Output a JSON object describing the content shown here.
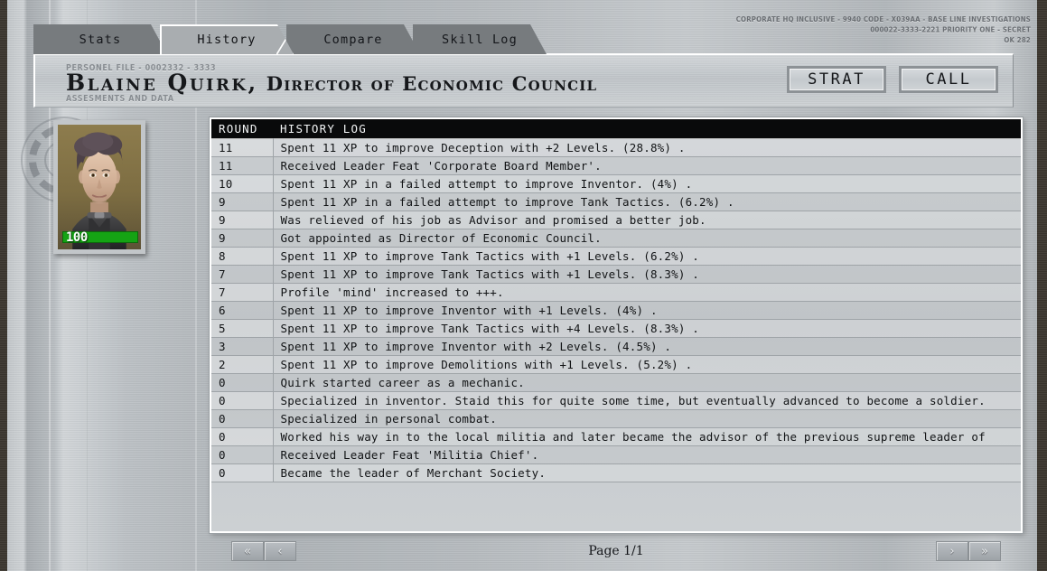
{
  "stamp": {
    "line1": "CORPORATE HQ INCLUSIVE - 9940 CODE - X039AA - BASE LINE INVESTIGATIONS",
    "line2": "000022-3333-2221 PRIORITY ONE - SECRET",
    "line3": "OK 282"
  },
  "tabs": [
    {
      "label": "Stats",
      "active": false
    },
    {
      "label": "History",
      "active": true
    },
    {
      "label": "Compare",
      "active": false
    },
    {
      "label": "Skill Log",
      "active": false
    }
  ],
  "header": {
    "file_label": "PERSONEL FILE - 0002332 - 3333",
    "data_label": "ASSESMENTS AND DATA",
    "name": "Blaine Quirk,",
    "role": "Director of Economic Council",
    "buttons": [
      {
        "label": "STRAT",
        "name": "strat-button"
      },
      {
        "label": "CALL",
        "name": "call-button"
      }
    ]
  },
  "portrait": {
    "health_value": "100",
    "health_percent": 100,
    "health_color": "#15a314"
  },
  "log": {
    "columns": [
      "ROUND",
      "HISTORY LOG"
    ],
    "rows": [
      {
        "round": "11",
        "text": "Spent 11 XP to improve Deception with +2 Levels. (28.8%) ."
      },
      {
        "round": "11",
        "text": "Received Leader Feat 'Corporate Board Member'."
      },
      {
        "round": "10",
        "text": "Spent 11 XP in a failed attempt to improve Inventor. (4%) ."
      },
      {
        "round": "9",
        "text": "Spent 11 XP in a failed attempt to improve Tank Tactics. (6.2%) ."
      },
      {
        "round": "9",
        "text": "Was relieved of his job as Advisor and promised a better job."
      },
      {
        "round": "9",
        "text": "Got appointed as Director of Economic Council."
      },
      {
        "round": "8",
        "text": "Spent 11 XP to improve Tank Tactics with +1 Levels. (6.2%) ."
      },
      {
        "round": "7",
        "text": "Spent 11 XP to improve Tank Tactics with +1 Levels. (8.3%) ."
      },
      {
        "round": "7",
        "text": "Profile 'mind' increased to +++."
      },
      {
        "round": "6",
        "text": "Spent 11 XP to improve Inventor with +1 Levels. (4%) ."
      },
      {
        "round": "5",
        "text": "Spent 11 XP to improve Tank Tactics with +4 Levels. (8.3%) ."
      },
      {
        "round": "3",
        "text": "Spent 11 XP to improve Inventor with +2 Levels. (4.5%) ."
      },
      {
        "round": "2",
        "text": "Spent 11 XP to improve Demolitions with +1 Levels. (5.2%) ."
      },
      {
        "round": "0",
        "text": "Quirk started career as a mechanic."
      },
      {
        "round": "0",
        "text": "Specialized in inventor. Staid this for quite some time, but eventually advanced to become a soldier."
      },
      {
        "round": "0",
        "text": "Specialized in personal combat."
      },
      {
        "round": "0",
        "text": "Worked his way in to the local militia and later became the advisor of the previous supreme leader of"
      },
      {
        "round": "0",
        "text": "Received Leader Feat 'Militia Chief'."
      },
      {
        "round": "0",
        "text": "Became the leader of Merchant Society."
      }
    ]
  },
  "pager": {
    "first": "«",
    "prev": "‹",
    "next": "›",
    "last": "»",
    "page_label": "Page 1/1"
  }
}
